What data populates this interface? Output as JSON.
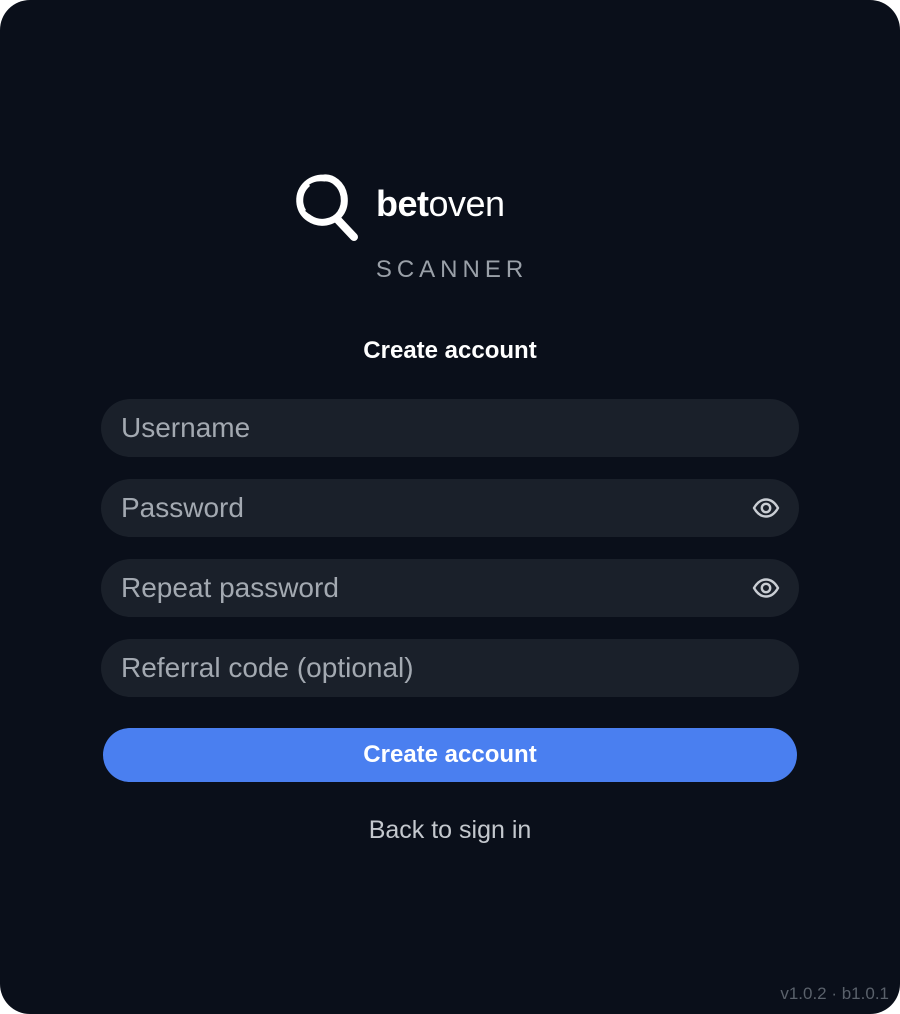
{
  "brand": {
    "name_bold": "bet",
    "name_light": "oven",
    "subtitle": "SCANNER",
    "logo_icon": "magnifier-logo-icon"
  },
  "form": {
    "heading": "Create account",
    "username": {
      "placeholder": "Username",
      "value": ""
    },
    "password": {
      "placeholder": "Password",
      "value": "",
      "toggle_icon": "eye-icon"
    },
    "repeat_password": {
      "placeholder": "Repeat password",
      "value": "",
      "toggle_icon": "eye-icon"
    },
    "referral": {
      "placeholder": "Referral code (optional)",
      "value": ""
    },
    "submit_label": "Create account",
    "back_link": "Back to sign in"
  },
  "footer": {
    "version": "v1.0.2 · b1.0.1"
  },
  "colors": {
    "background": "#0a0f1a",
    "field_bg": "#1a202a",
    "accent": "#4a7ff0",
    "text": "#ffffff",
    "muted": "#9aa0a8"
  }
}
